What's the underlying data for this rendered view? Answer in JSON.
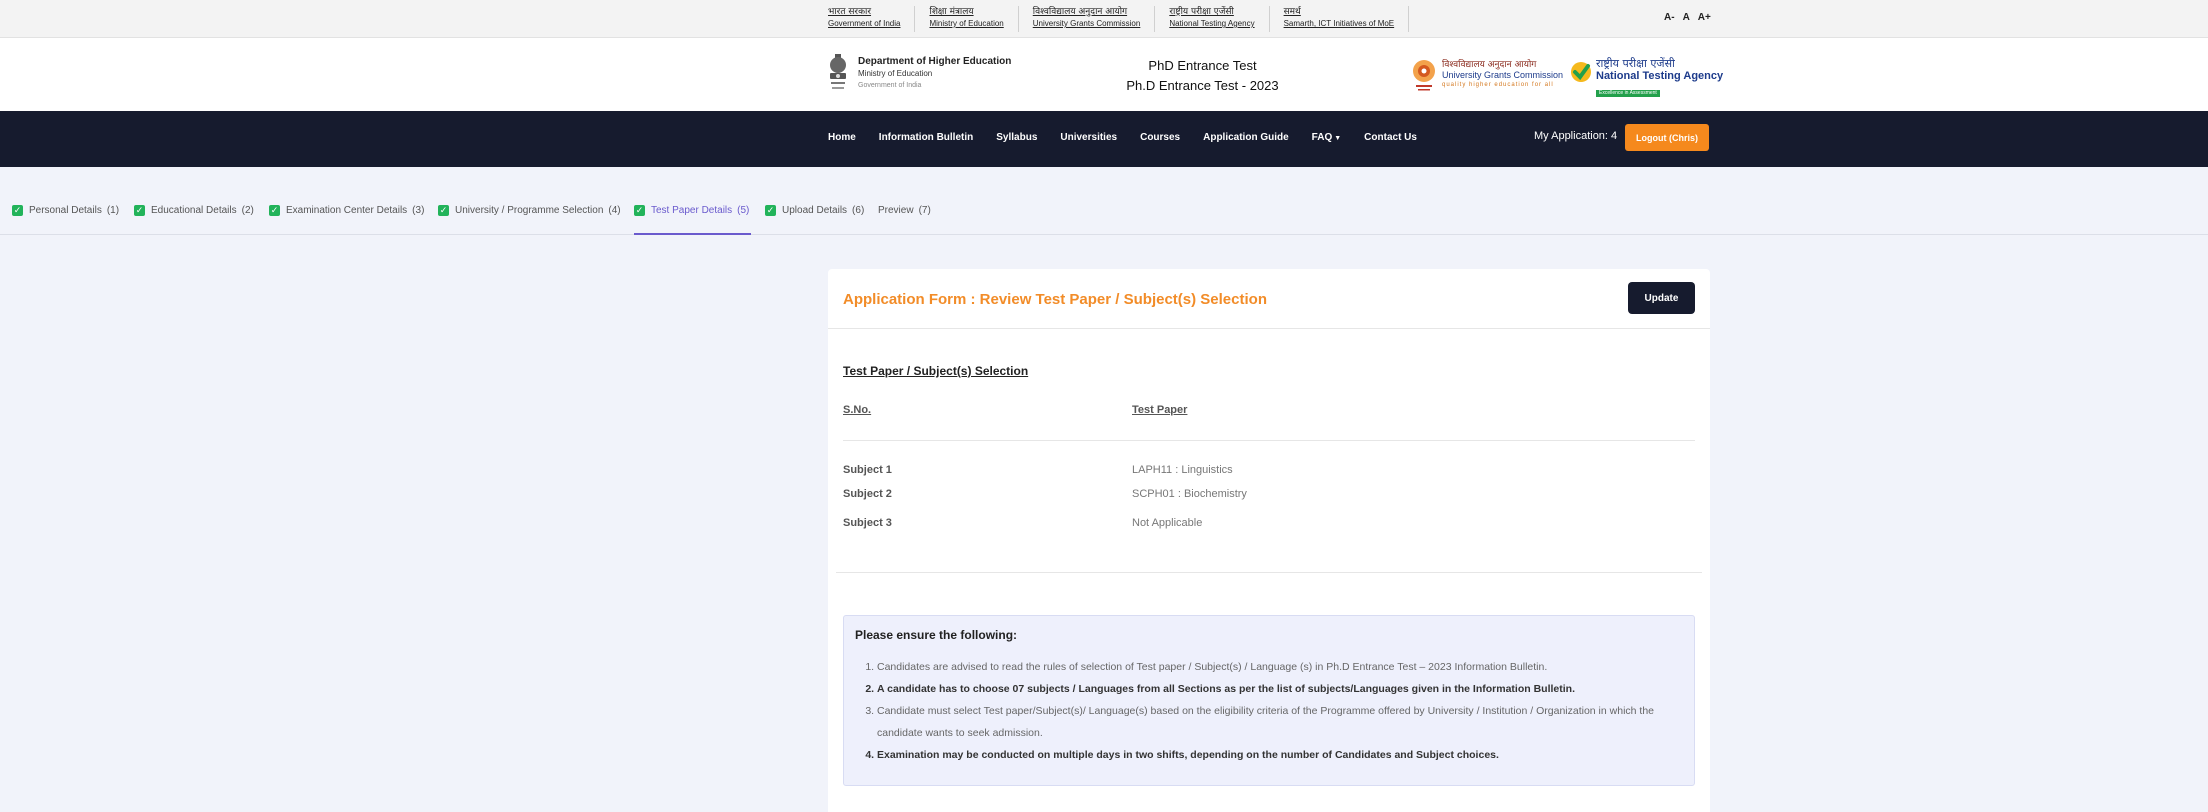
{
  "gov_bar": {
    "links": [
      {
        "hindi": "भारत सरकार",
        "english": "Government of India"
      },
      {
        "hindi": "शिक्षा मंत्रालय",
        "english": "Ministry of Education"
      },
      {
        "hindi": "विश्वविद्यालय अनुदान आयोग",
        "english": "University Grants Commission"
      },
      {
        "hindi": "राष्ट्रीय परीक्षा एजेंसी",
        "english": "National Testing Agency"
      },
      {
        "hindi": "समर्थ",
        "english": "Samarth, ICT Initiatives of MoE"
      }
    ],
    "font_controls": [
      "A-",
      "A",
      "A+"
    ]
  },
  "header": {
    "dept_title": "Department of Higher Education",
    "dept_ministry": "Ministry of Education",
    "dept_gov": "Government of India",
    "exam_line1": "PhD Entrance Test",
    "exam_line2": "Ph.D Entrance Test - 2023",
    "ugc_hindi": "विश्वविद्यालय अनुदान आयोग",
    "ugc_english": "University Grants Commission",
    "ugc_tagline": "quality higher education for all",
    "nta_hindi": "राष्ट्रीय परीक्षा एजेंसी",
    "nta_english": "National Testing Agency",
    "nta_tagline": "Excellence in Assessment"
  },
  "nav": {
    "items": [
      "Home",
      "Information Bulletin",
      "Syllabus",
      "Universities",
      "Courses",
      "Application Guide",
      "FAQ",
      "Contact Us"
    ],
    "my_application": "My Application: 4",
    "logout": "Logout (Chris)"
  },
  "steps": [
    {
      "label": "Personal Details",
      "num": "(1)",
      "done": true
    },
    {
      "label": "Educational Details",
      "num": "(2)",
      "done": true
    },
    {
      "label": "Examination Center Details",
      "num": "(3)",
      "done": true
    },
    {
      "label": "University / Programme Selection",
      "num": "(4)",
      "done": true
    },
    {
      "label": "Test Paper Details",
      "num": "(5)",
      "done": true,
      "active": true
    },
    {
      "label": "Upload Details",
      "num": "(6)",
      "done": true
    },
    {
      "label": "Preview",
      "num": "(7)",
      "done": false
    }
  ],
  "form": {
    "title": "Application Form : Review Test Paper / Subject(s) Selection",
    "update_label": "Update",
    "section_title": "Test Paper / Subject(s) Selection",
    "col_sno": "S.No.",
    "col_test_paper": "Test Paper",
    "subjects": [
      {
        "label": "Subject 1",
        "value": "LAPH11 : Linguistics"
      },
      {
        "label": "Subject 2",
        "value": "SCPH01 : Biochemistry"
      },
      {
        "label": "Subject 3",
        "value": "Not Applicable"
      }
    ]
  },
  "notice": {
    "title": "Please ensure the following:",
    "items": [
      "Candidates are advised to read the rules of selection of Test paper / Subject(s) / Language (s) in Ph.D Entrance Test – 2023 Information Bulletin.",
      "A candidate has to choose 07 subjects / Languages from all Sections as per the list of subjects/Languages given in the Information Bulletin.",
      "Candidate must select Test paper/Subject(s)/ Language(s) based on the eligibility criteria of the Programme offered by University / Institution / Organization in which the candidate wants to seek admission.",
      "Examination may be conducted on multiple days in two shifts, depending on the number of Candidates and Subject choices."
    ]
  },
  "colors": {
    "navbar": "#161b2e",
    "accent_orange": "#f28c28",
    "logout_orange": "#f5891d",
    "active_step": "#6a5acd",
    "check_green": "#22b35a"
  }
}
